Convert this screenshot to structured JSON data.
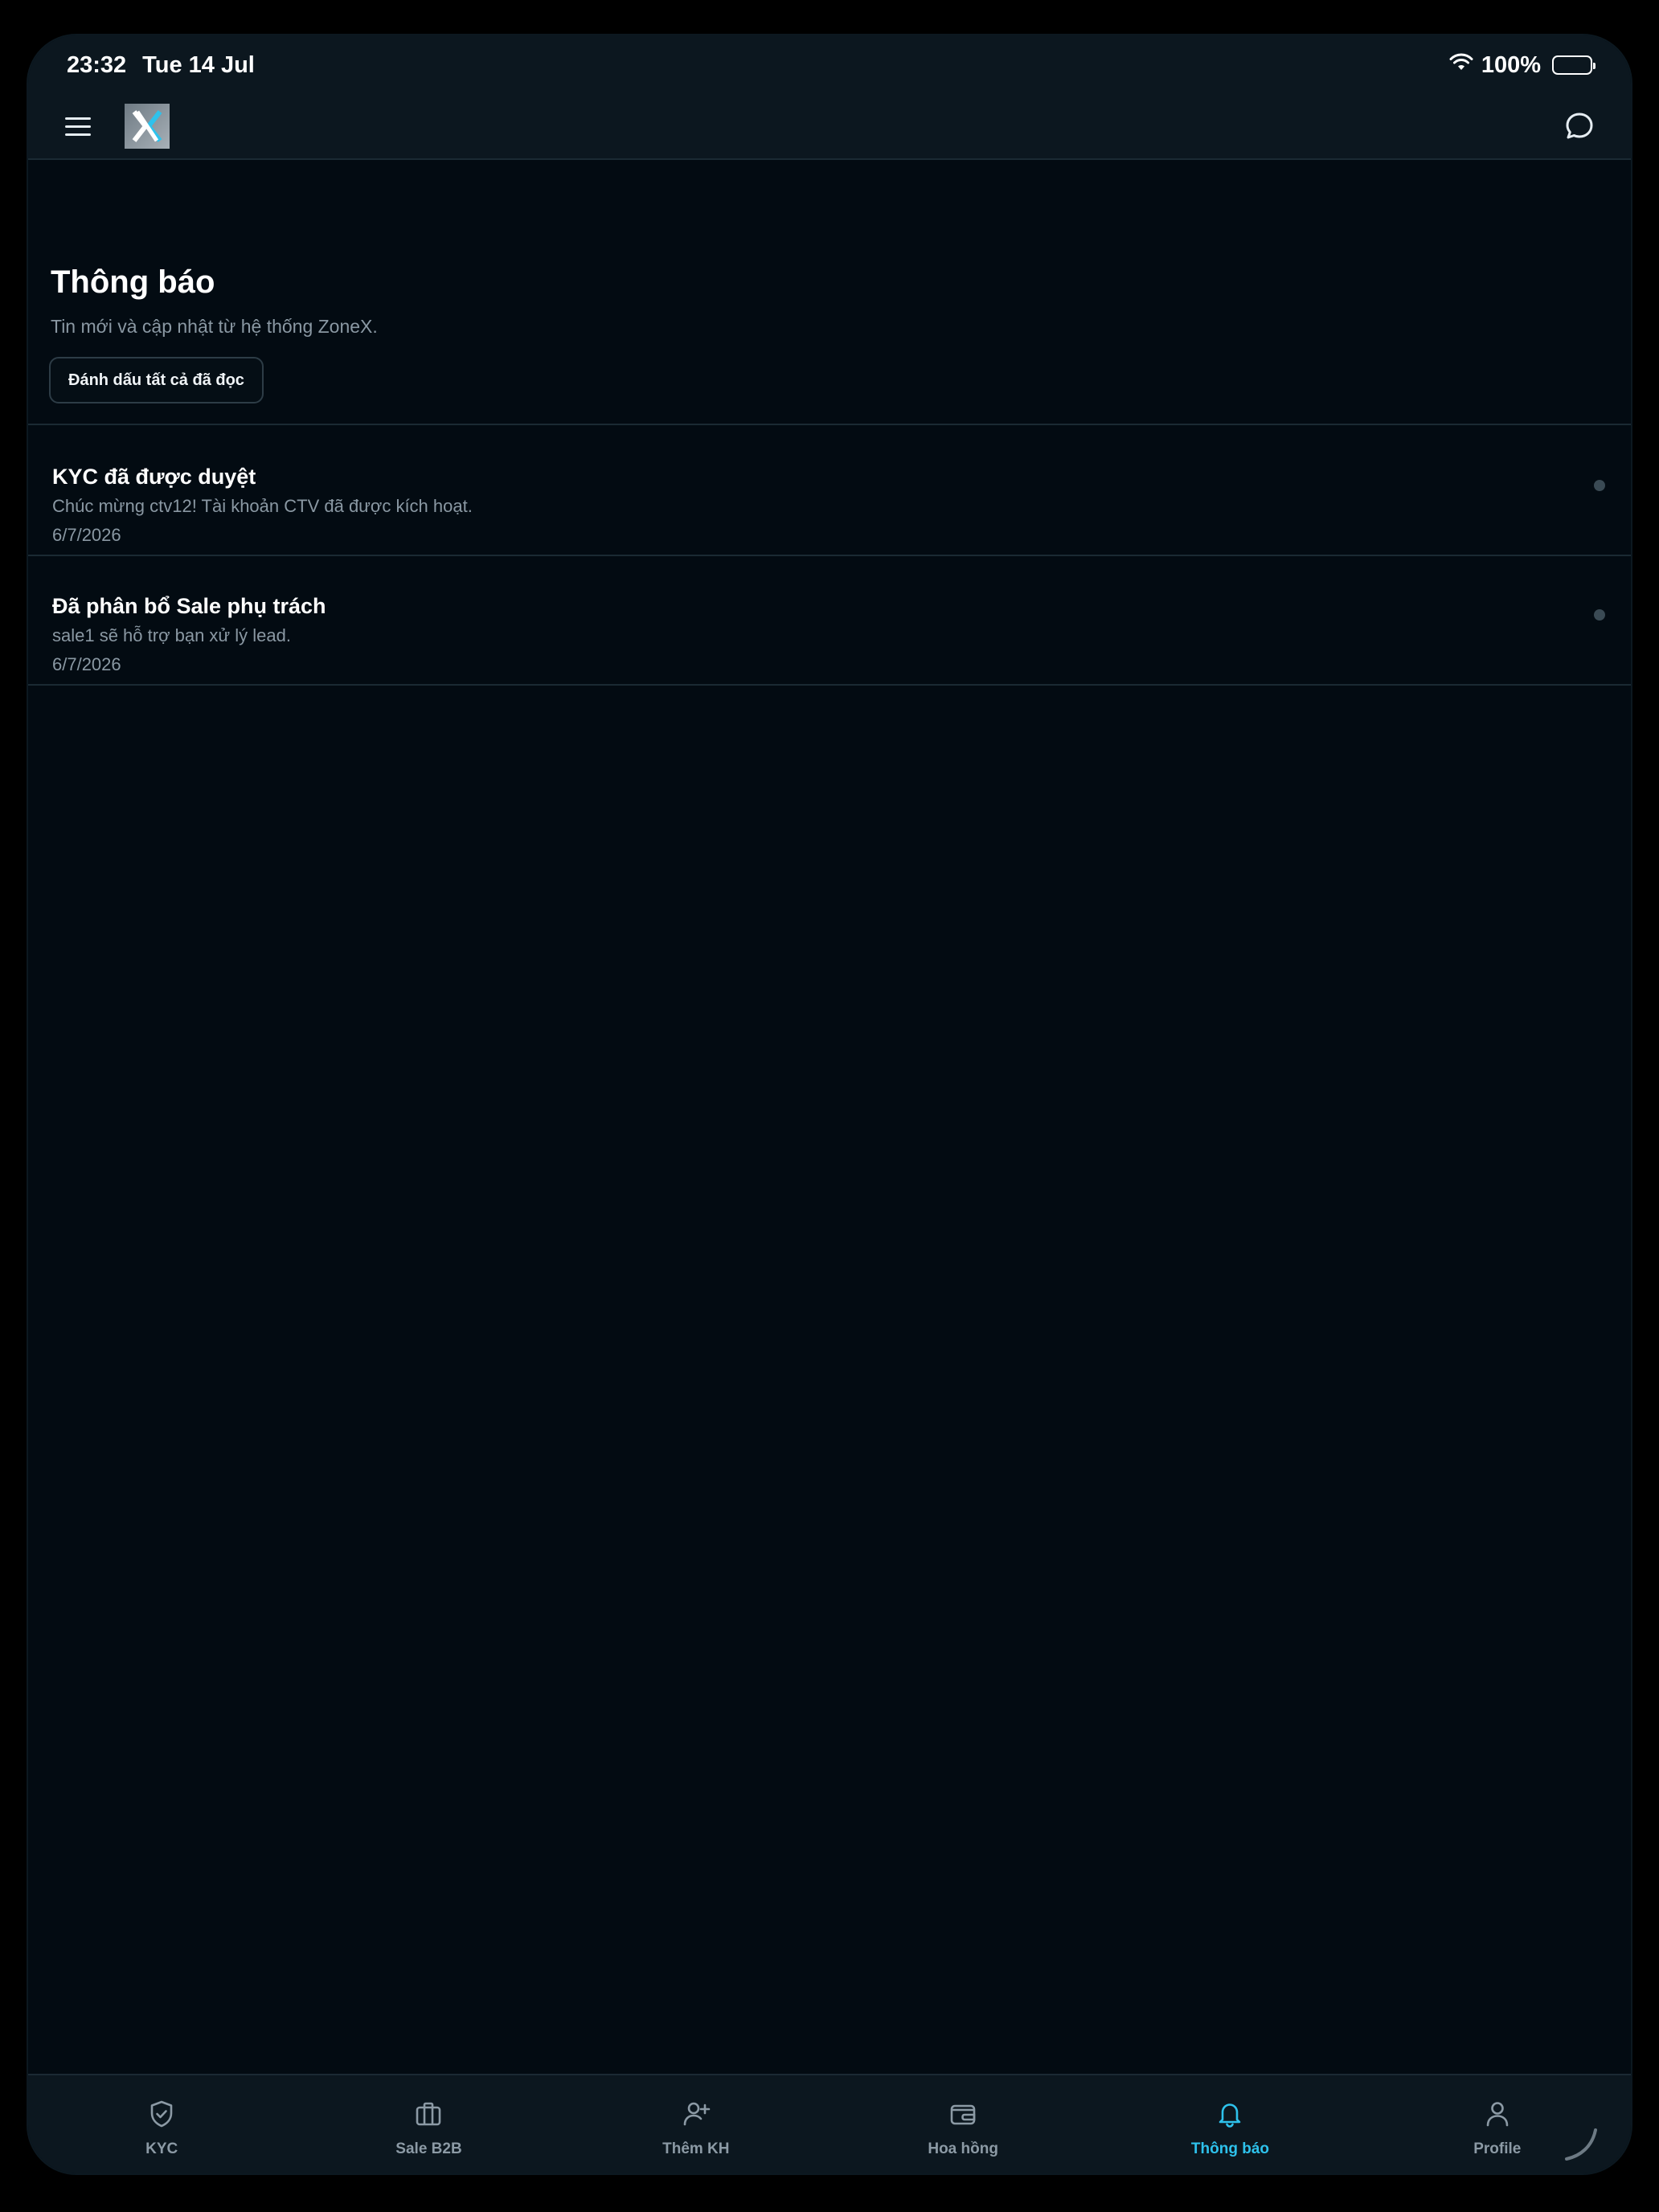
{
  "status_bar": {
    "time": "23:32",
    "date": "Tue 14 Jul",
    "battery": "100%",
    "icons": [
      "wifi-icon",
      "battery-icon"
    ]
  },
  "header": {
    "menu_icon": "hamburger-menu-icon",
    "logo": "zonex-logo",
    "chat_icon": "chat-bubble-icon"
  },
  "page": {
    "title": "Thông báo",
    "subtitle": "Tin mới và cập nhật từ hệ thống ZoneX.",
    "mark_all_read_label": "Đánh dấu tất cả đã đọc"
  },
  "notifications": [
    {
      "title": "KYC đã được duyệt",
      "body": "Chúc mừng ctv12! Tài khoản CTV đã được kích hoạt.",
      "date": "6/7/2026",
      "unread": true
    },
    {
      "title": "Đã phân bổ Sale phụ trách",
      "body": "sale1 sẽ hỗ trợ bạn xử lý lead.",
      "date": "6/7/2026",
      "unread": true
    }
  ],
  "tabbar": {
    "tabs": [
      {
        "label": "KYC",
        "icon": "shield-check-icon",
        "active": false
      },
      {
        "label": "Sale B2B",
        "icon": "briefcase-icon",
        "active": false
      },
      {
        "label": "Thêm KH",
        "icon": "user-plus-icon",
        "active": false
      },
      {
        "label": "Hoa hồng",
        "icon": "wallet-icon",
        "active": false
      },
      {
        "label": "Thông báo",
        "icon": "bell-icon",
        "active": true
      },
      {
        "label": "Profile",
        "icon": "user-icon",
        "active": false
      }
    ]
  },
  "colors": {
    "background": "#030b12",
    "panel": "#0c171f",
    "accent": "#2ec2ec",
    "muted_text": "#8a98a3"
  }
}
